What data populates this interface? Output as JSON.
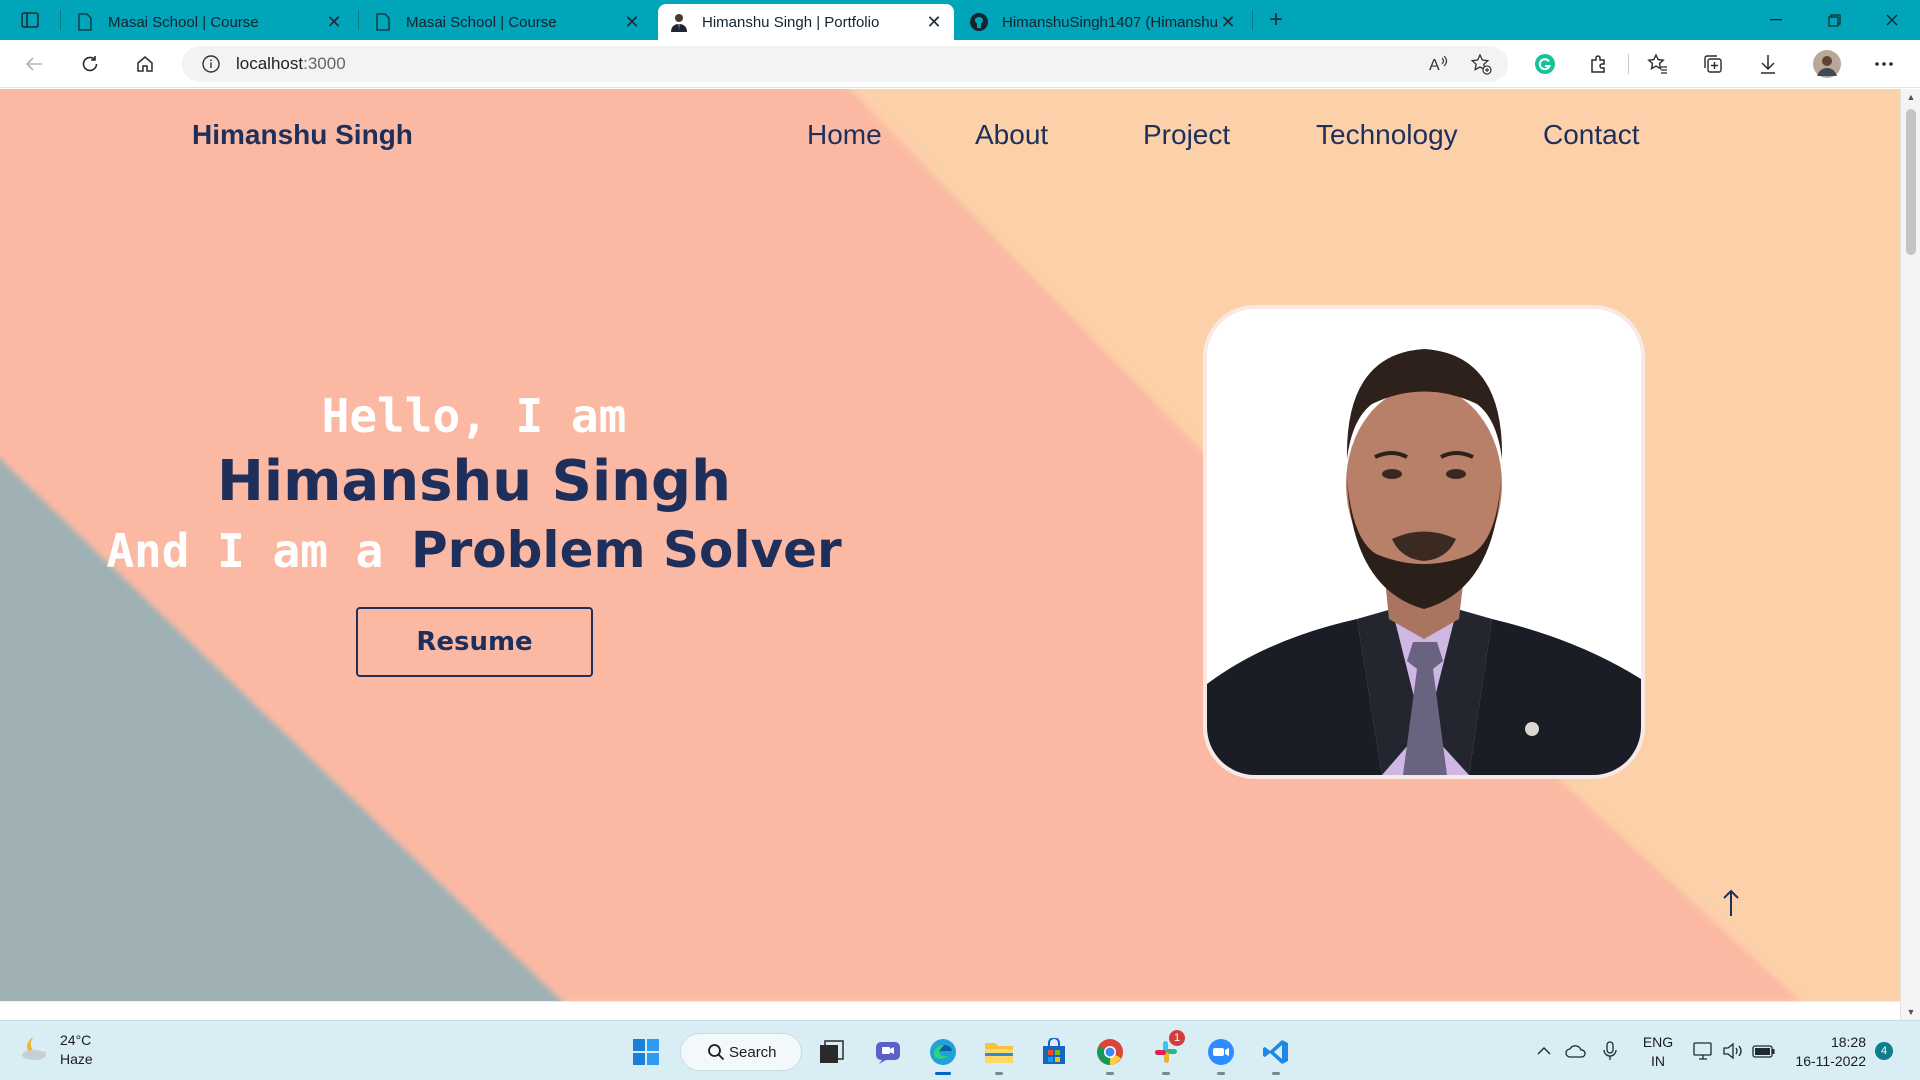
{
  "browser": {
    "tabs": [
      {
        "title": "Masai School | Course",
        "icon": "page-icon"
      },
      {
        "title": "Masai School | Course",
        "icon": "page-icon"
      },
      {
        "title": "Himanshu Singh | Portfolio",
        "icon": "avatar-icon",
        "active": true
      },
      {
        "title": "HimanshuSingh1407 (Himanshu",
        "icon": "github-icon"
      }
    ],
    "url_host": "localhost",
    "url_port": ":3000"
  },
  "site": {
    "logo": "Himanshu Singh",
    "nav": [
      "Home",
      "About",
      "Project",
      "Technology",
      "Contact"
    ],
    "hero": {
      "greeting": "Hello, I am",
      "name": "Himanshu Singh",
      "tagline_prefix": "And I am a",
      "role": "Problem Solver",
      "resume_label": "Resume"
    },
    "colors": {
      "background_peach": "#fcd0a8",
      "background_salmon": "#fbb9a3",
      "background_slate": "#9fb1b5",
      "navy": "#1e2f5c"
    }
  },
  "taskbar": {
    "weather_temp": "24°C",
    "weather_desc": "Haze",
    "search_label": "Search",
    "slack_badge": "1",
    "lang_line1": "ENG",
    "lang_line2": "IN",
    "time": "18:28",
    "date": "16-11-2022",
    "notification_count": "4"
  }
}
